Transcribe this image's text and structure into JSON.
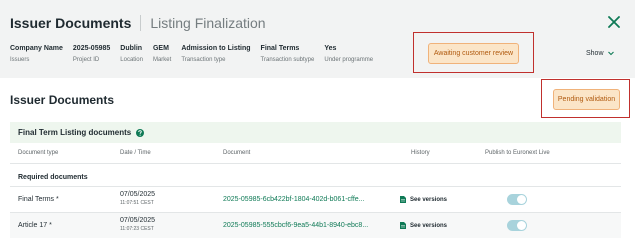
{
  "header": {
    "title": "Issuer Documents",
    "subtitle": "Listing Finalization",
    "show_label": "Show",
    "meta": [
      {
        "value": "Company Name",
        "label": "Issuers"
      },
      {
        "value": "2025-05985",
        "label": "Project ID"
      },
      {
        "value": "Dublin",
        "label": "Location"
      },
      {
        "value": "GEM",
        "label": "Market"
      },
      {
        "value": "Admission to Listing",
        "label": "Transaction type"
      },
      {
        "value": "Final Terms",
        "label": "Transaction subtype"
      },
      {
        "value": "Yes",
        "label": "Under programme"
      }
    ],
    "status_badge": "Awaiting customer review"
  },
  "section": {
    "title": "Issuer Documents",
    "status_badge": "Pending validation",
    "panel_title": "Final Term Listing documents"
  },
  "table": {
    "columns": [
      "Document type",
      "Date / Time",
      "Document",
      "History",
      "Publish to Euronext Live"
    ],
    "group_label": "Required documents",
    "rows": [
      {
        "type": "Final Terms *",
        "date": "07/05/2025",
        "time": "11:07:51 CEST",
        "document": "2025-05985-6cb422bf-1804-402d-b061-cffe...",
        "history": "See versions",
        "publish": true
      },
      {
        "type": "Article 17 *",
        "date": "07/05/2025",
        "time": "11:07:23 CEST",
        "document": "2025-05985-555cbcf6-9ea5-44b1-8940-ebc8...",
        "history": "See versions",
        "publish": true
      }
    ]
  },
  "colors": {
    "accent": "#0f7a56",
    "badge_bg": "#fbe5c8",
    "badge_text": "#b05a0f",
    "highlight": "#c0302d",
    "toggle": "#a8d3dc"
  },
  "icons": {
    "close": "close-icon",
    "show": "chevron-down-icon",
    "help": "help-icon",
    "history": "document-icon"
  }
}
